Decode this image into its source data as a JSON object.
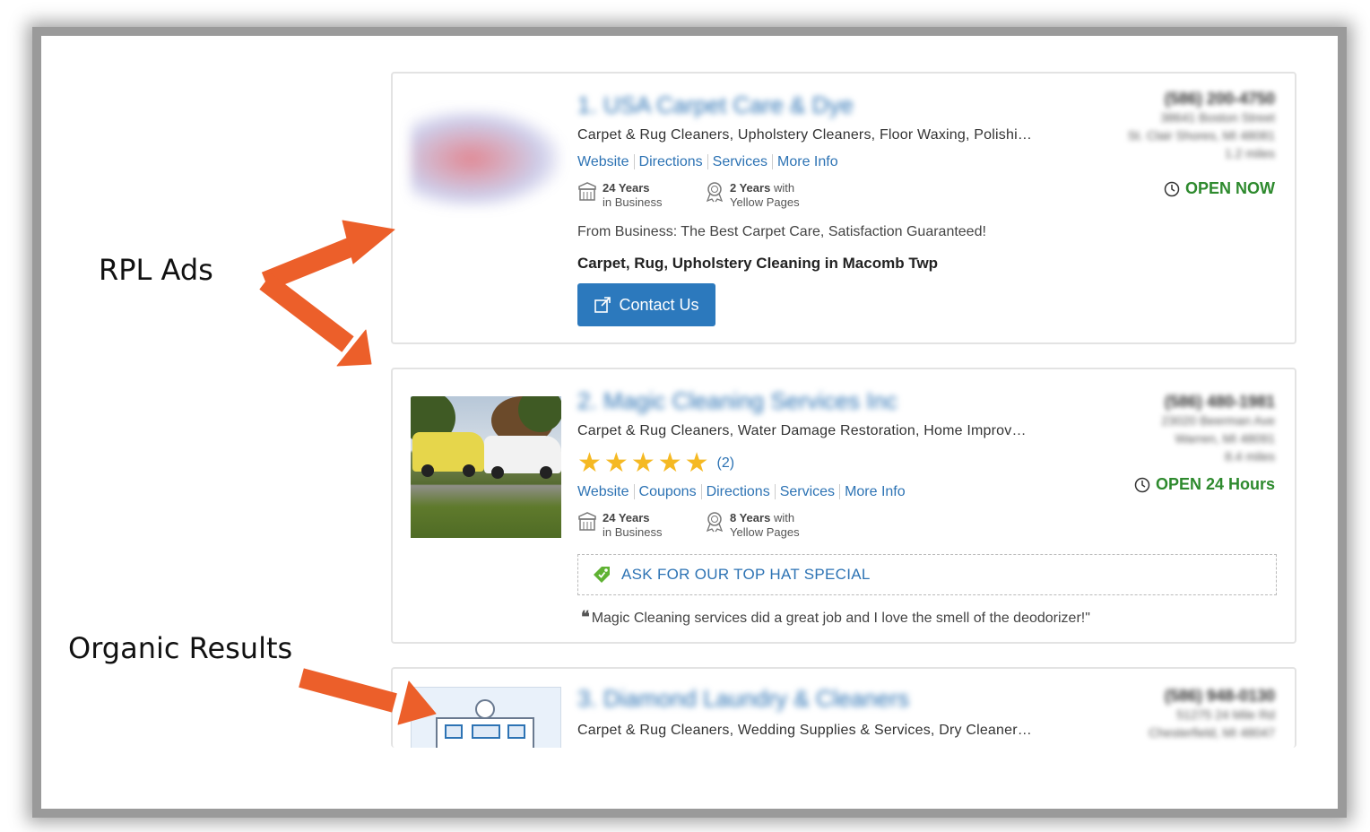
{
  "annotations": {
    "rpl_ads": "RPL Ads",
    "organic_results": "Organic Results"
  },
  "colors": {
    "arrow": "#ec5f2a",
    "link": "#2d73b4",
    "open": "#2e8a2e",
    "button": "#2c79bd",
    "star": "#f5b923"
  },
  "listings": [
    {
      "title": "1. USA Carpet Care & Dye",
      "categories": "Carpet & Rug Cleaners, Upholstery Cleaners, Floor Waxing, Polishi…",
      "links": [
        "Website",
        "Directions",
        "Services",
        "More Info"
      ],
      "years_business": {
        "bold": "24 Years",
        "rest": "in Business"
      },
      "years_yp": {
        "bold": "2 Years",
        "rest1": "with",
        "rest2": "Yellow Pages"
      },
      "from_business": "From Business: The Best Carpet Care, Satisfaction Guaranteed!",
      "headline": "Carpet, Rug, Upholstery Cleaning in Macomb Twp",
      "button": "Contact Us",
      "phone": "(586) 200-4750",
      "address1": "38641 Boston Street",
      "address2": "St. Clair Shores, MI 48081",
      "distance": "1.2 miles",
      "status": "OPEN NOW"
    },
    {
      "title": "2. Magic Cleaning Services Inc",
      "categories": "Carpet & Rug Cleaners, Water Damage Restoration, Home Improv…",
      "rating": 5,
      "review_count": "(2)",
      "links": [
        "Website",
        "Coupons",
        "Directions",
        "Services",
        "More Info"
      ],
      "years_business": {
        "bold": "24 Years",
        "rest": "in Business"
      },
      "years_yp": {
        "bold": "8 Years",
        "rest1": "with",
        "rest2": "Yellow Pages"
      },
      "coupon": "ASK FOR OUR TOP HAT SPECIAL",
      "review": "Magic Cleaning services did a great job and I love the smell of the deodorizer!\"",
      "phone": "(586) 480-1981",
      "address1": "23020 Beerman Ave",
      "address2": "Warren, MI 48091",
      "distance": "8.4 miles",
      "status": "OPEN 24 Hours"
    },
    {
      "title": "3. Diamond Laundry & Cleaners",
      "categories": "Carpet & Rug Cleaners, Wedding Supplies & Services, Dry Cleaner…",
      "phone": "(586) 948-0130",
      "address1": "51275 24 Mile Rd",
      "address2": "Chesterfield, MI 48047"
    }
  ]
}
